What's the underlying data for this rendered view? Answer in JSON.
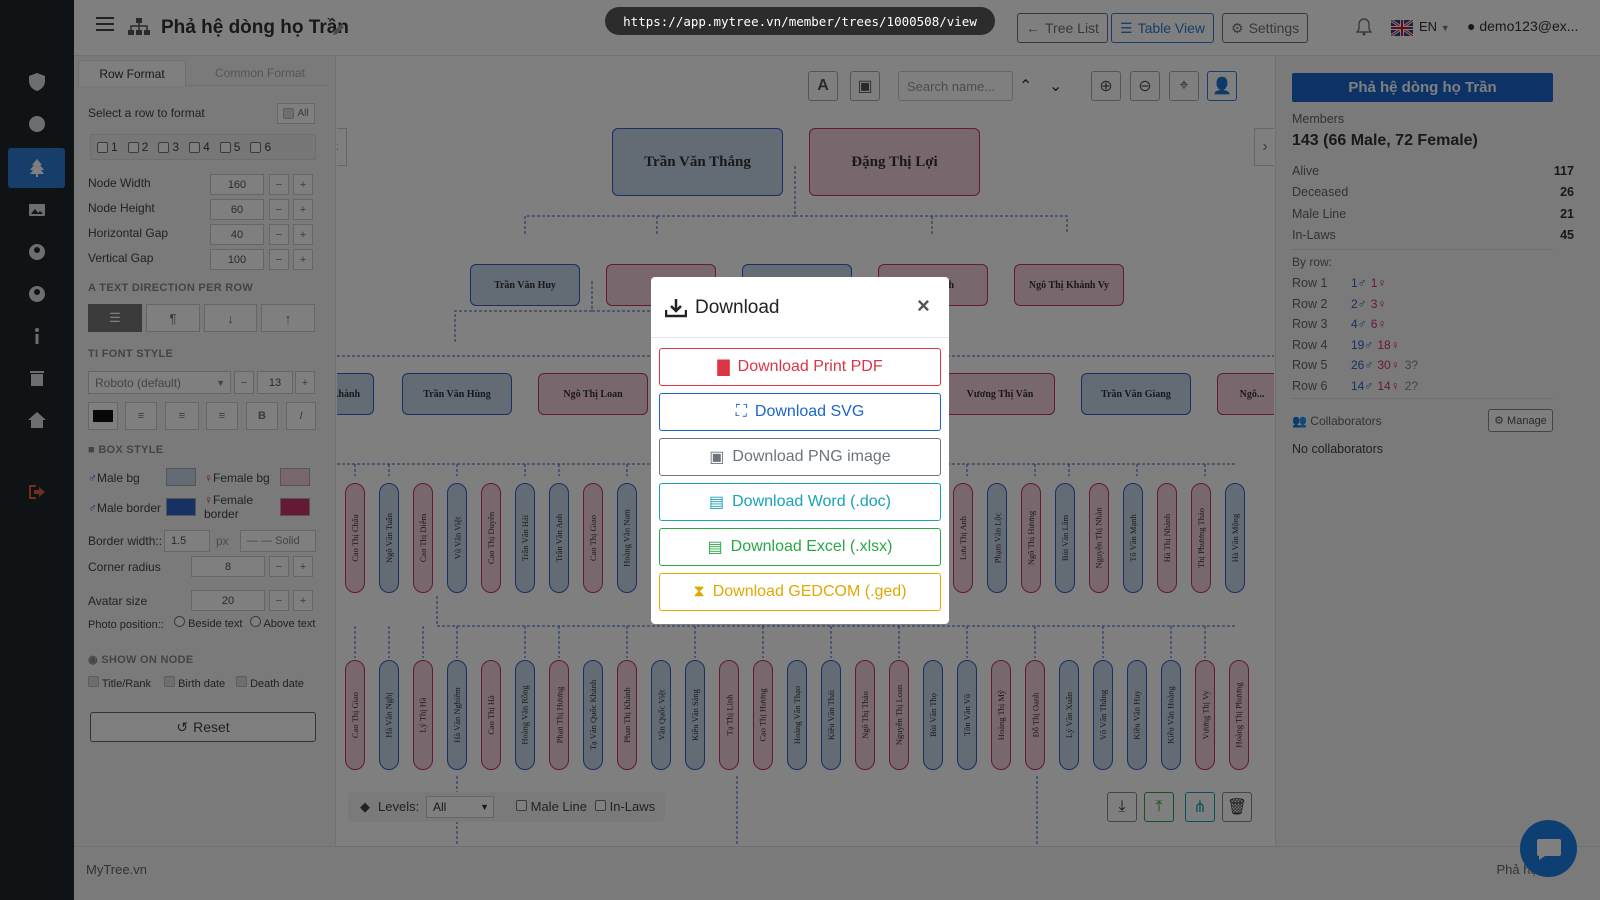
{
  "url": "https://app.mytree.vn/member/trees/1000508/view",
  "header": {
    "title": "Phả hệ dòng họ Trần",
    "tree_list": "Tree List",
    "table_view": "Table View",
    "settings": "Settings",
    "lang": "EN",
    "user": "demo123@ex..."
  },
  "left": {
    "tab_row": "Row Format",
    "tab_common": "Common Format",
    "select_row": "Select a row to format",
    "all": "All",
    "rows": [
      "1",
      "2",
      "3",
      "4",
      "5",
      "6"
    ],
    "node_width_label": "Node Width",
    "node_width": "160",
    "node_height_label": "Node Height",
    "node_height": "60",
    "hgap_label": "Horizontal Gap",
    "hgap": "40",
    "vgap_label": "Vertical Gap",
    "vgap": "100",
    "text_dir": "TEXT DIRECTION PER ROW",
    "font_style": "FONT STYLE",
    "font_family": "Roboto (default)",
    "font_size": "13",
    "box_style": "BOX STYLE",
    "male_bg": "Male bg",
    "female_bg": "Female bg",
    "male_border": "Male border",
    "female_border": "Female border",
    "border_width_label": "Border width::",
    "border_width": "1.5",
    "px": "px",
    "border_style": "— — Solid",
    "corner_label": "Corner radius",
    "corner": "8",
    "avatar_label": "Avatar size",
    "avatar": "20",
    "photo_label": "Photo position::",
    "beside": "Beside text",
    "above": "Above text",
    "show_on_node": "SHOW ON NODE",
    "title_rank": "Title/Rank",
    "birth": "Birth date",
    "death": "Death date",
    "reset": "Reset",
    "minus": "−",
    "plus": "+"
  },
  "canvas": {
    "search_placeholder": "Search name...",
    "levels_label": "Levels:",
    "levels_value": "All",
    "male_line": "Male Line",
    "in_laws": "In-Laws",
    "couple": [
      "Trần Văn Thắng",
      "Đặng Thị Lợi"
    ],
    "row2": [
      "Trần Văn Huy",
      "",
      "",
      "...i Khánh",
      "Ngô Thị Khánh Vy"
    ],
    "row3": [
      "...hành",
      "Trần Văn Hùng",
      "Ngô Thị Loan",
      "Vương Thị Vân",
      "Trần Văn Giang",
      "Ngô..."
    ],
    "row4": [
      {
        "n": "Cao Thị Châu",
        "g": "f"
      },
      {
        "n": "Ngô Văn Tuấn",
        "g": "m"
      },
      {
        "n": "Cao Thị Diễm",
        "g": "f"
      },
      {
        "n": "Vũ Văn Việt",
        "g": "m"
      },
      {
        "n": "Cao Thị Duyên",
        "g": "f"
      },
      {
        "n": "Trần Văn Hải",
        "g": "m"
      },
      {
        "n": "Trần Văn Anh",
        "g": "m"
      },
      {
        "n": "Cao Thị Giao",
        "g": "f"
      },
      {
        "n": "Hoàng Văn Nam",
        "g": "m"
      },
      {
        "n": "Phan Thị Yến",
        "g": "f"
      },
      {
        "n": "Lưu Thị Anh",
        "g": "f"
      },
      {
        "n": "Phạm Văn Lộc",
        "g": "m"
      },
      {
        "n": "Ngô Thị Hương",
        "g": "f"
      },
      {
        "n": "Bùi Văn Lâm",
        "g": "m"
      },
      {
        "n": "Nguyễn Thị Nhàn",
        "g": "f"
      },
      {
        "n": "Tô Văn Mạnh",
        "g": "m"
      },
      {
        "n": "Hà Thị Nhành",
        "g": "f"
      },
      {
        "n": "Thị Phương Thảo",
        "g": "f"
      },
      {
        "n": "Hà Văn Mộng",
        "g": "m"
      }
    ],
    "row5": [
      {
        "n": "Cao Thị Giao",
        "g": "f"
      },
      {
        "n": "Hà Văn Nghị",
        "g": "m"
      },
      {
        "n": "Lý Thị Hà",
        "g": "f"
      },
      {
        "n": "Hà Văn Nghiêm",
        "g": "m"
      },
      {
        "n": "Cao Thị Hà",
        "g": "f"
      },
      {
        "n": "Hoàng Văn Rồng",
        "g": "m"
      },
      {
        "n": "Phan Thị Hương",
        "g": "f"
      },
      {
        "n": "Tạ Văn Quốc Khánh",
        "g": "m"
      },
      {
        "n": "Phan Thị Khánh",
        "g": "f"
      },
      {
        "n": "Vân Quốc Việt",
        "g": "m"
      },
      {
        "n": "Kiều Văn Sáng",
        "g": "m"
      },
      {
        "n": "Tạ Thị Linh",
        "g": "f"
      },
      {
        "n": "Cao Thị Hương",
        "g": "f"
      },
      {
        "n": "Hoàng Văn Thạo",
        "g": "m"
      },
      {
        "n": "Kiều Văn Thái",
        "g": "m"
      },
      {
        "n": "Ngô Thị Thảo",
        "g": "f"
      },
      {
        "n": "Nguyễn Thị Loan",
        "g": "f"
      },
      {
        "n": "Bùi Văn Thọ",
        "g": "m"
      },
      {
        "n": "Tôn Văn Vũ",
        "g": "m"
      },
      {
        "n": "Hoàng Thị Mỹ",
        "g": "f"
      },
      {
        "n": "Đỗ Thị Oanh",
        "g": "f"
      },
      {
        "n": "Lý Văn Xuân",
        "g": "m"
      },
      {
        "n": "Võ Văn Thắng",
        "g": "m"
      },
      {
        "n": "Kiều Văn Huy",
        "g": "m"
      },
      {
        "n": "Kiều Văn Hoàng",
        "g": "m"
      },
      {
        "n": "Vương Thị Vy",
        "g": "f"
      },
      {
        "n": "Hoàng Thị Phương",
        "g": "f"
      }
    ]
  },
  "right": {
    "title": "Phả hệ dòng họ Trần",
    "members_label": "Members",
    "members": "143 (66 Male, 72 Female)",
    "stats": [
      {
        "label": "Alive",
        "value": "117"
      },
      {
        "label": "Deceased",
        "value": "26"
      },
      {
        "label": "Male Line",
        "value": "21"
      },
      {
        "label": "In-Laws",
        "value": "45"
      }
    ],
    "by_row_label": "By row:",
    "by_row": [
      {
        "label": "Row 1",
        "m": "1♂",
        "f": "1♀",
        "u": ""
      },
      {
        "label": "Row 2",
        "m": "2♂",
        "f": "3♀",
        "u": ""
      },
      {
        "label": "Row 3",
        "m": "4♂",
        "f": "6♀",
        "u": ""
      },
      {
        "label": "Row 4",
        "m": "19♂",
        "f": "18♀",
        "u": ""
      },
      {
        "label": "Row 5",
        "m": "26♂",
        "f": "30♀",
        "u": "3?"
      },
      {
        "label": "Row 6",
        "m": "14♂",
        "f": "14♀",
        "u": "2?"
      }
    ],
    "collaborators": "Collaborators",
    "manage": "Manage",
    "no_collab": "No collaborators"
  },
  "footer": {
    "left": "MyTree.vn",
    "right": "Phả hệ số"
  },
  "modal": {
    "title": "Download",
    "close": "×",
    "buttons": [
      {
        "label": "Download Print PDF",
        "color": "#dc3545"
      },
      {
        "label": "Download SVG",
        "color": "#1a66cc"
      },
      {
        "label": "Download PNG image",
        "color": "#6c757d"
      },
      {
        "label": "Download Word (.doc)",
        "color": "#17a2b8"
      },
      {
        "label": "Download Excel (.xlsx)",
        "color": "#28a745"
      },
      {
        "label": "Download GEDCOM (.ged)",
        "color": "#e0a800"
      }
    ]
  },
  "colors": {
    "male_bg": "#c7d6ea",
    "female_bg": "#f0cfd9",
    "male_border": "#2f62c4",
    "female_border": "#c8336d",
    "sidebar": "#20262c",
    "primary": "#1a66cc"
  }
}
